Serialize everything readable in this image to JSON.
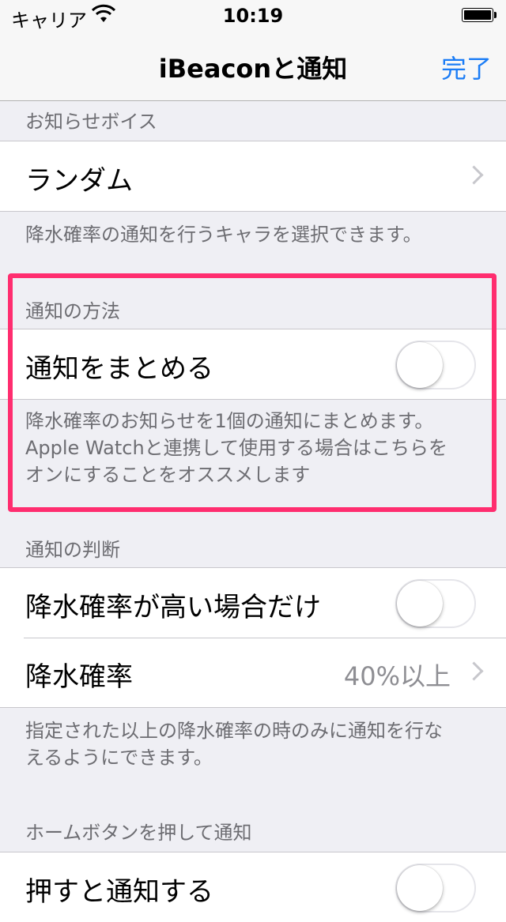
{
  "status_bar": {
    "carrier": "キャリア",
    "time": "10:19",
    "wifi_icon": "wifi-icon",
    "battery_icon": "battery-icon"
  },
  "nav": {
    "title": "iBeaconと通知",
    "done_label": "完了",
    "accent_color": "#1a7cf6"
  },
  "sections": {
    "voice": {
      "header": "お知らせボイス",
      "row_label": "ランダム",
      "footer": "降水確率の通知を行うキャラを選択できます。"
    },
    "method": {
      "header": "通知の方法",
      "row_label": "通知をまとめる",
      "toggle_on": false,
      "footer_lines": [
        "降水確率のお知らせを1個の通知にまとめます。",
        "Apple Watchと連携して使用する場合はこちらを",
        "オンにすることをオススメします"
      ]
    },
    "judgment": {
      "header": "通知の判断",
      "rows": [
        {
          "label": "降水確率が高い場合だけ",
          "toggle_on": false
        },
        {
          "label": "降水確率",
          "detail": "40%以上"
        }
      ],
      "footer_lines": [
        "指定された以上の降水確率の時のみに通知を行な",
        "えるようにできます。"
      ]
    },
    "home_button": {
      "header": "ホームボタンを押して通知",
      "row_label": "押すと通知する",
      "toggle_on": false
    }
  },
  "highlight_color": "#ff2d6f"
}
